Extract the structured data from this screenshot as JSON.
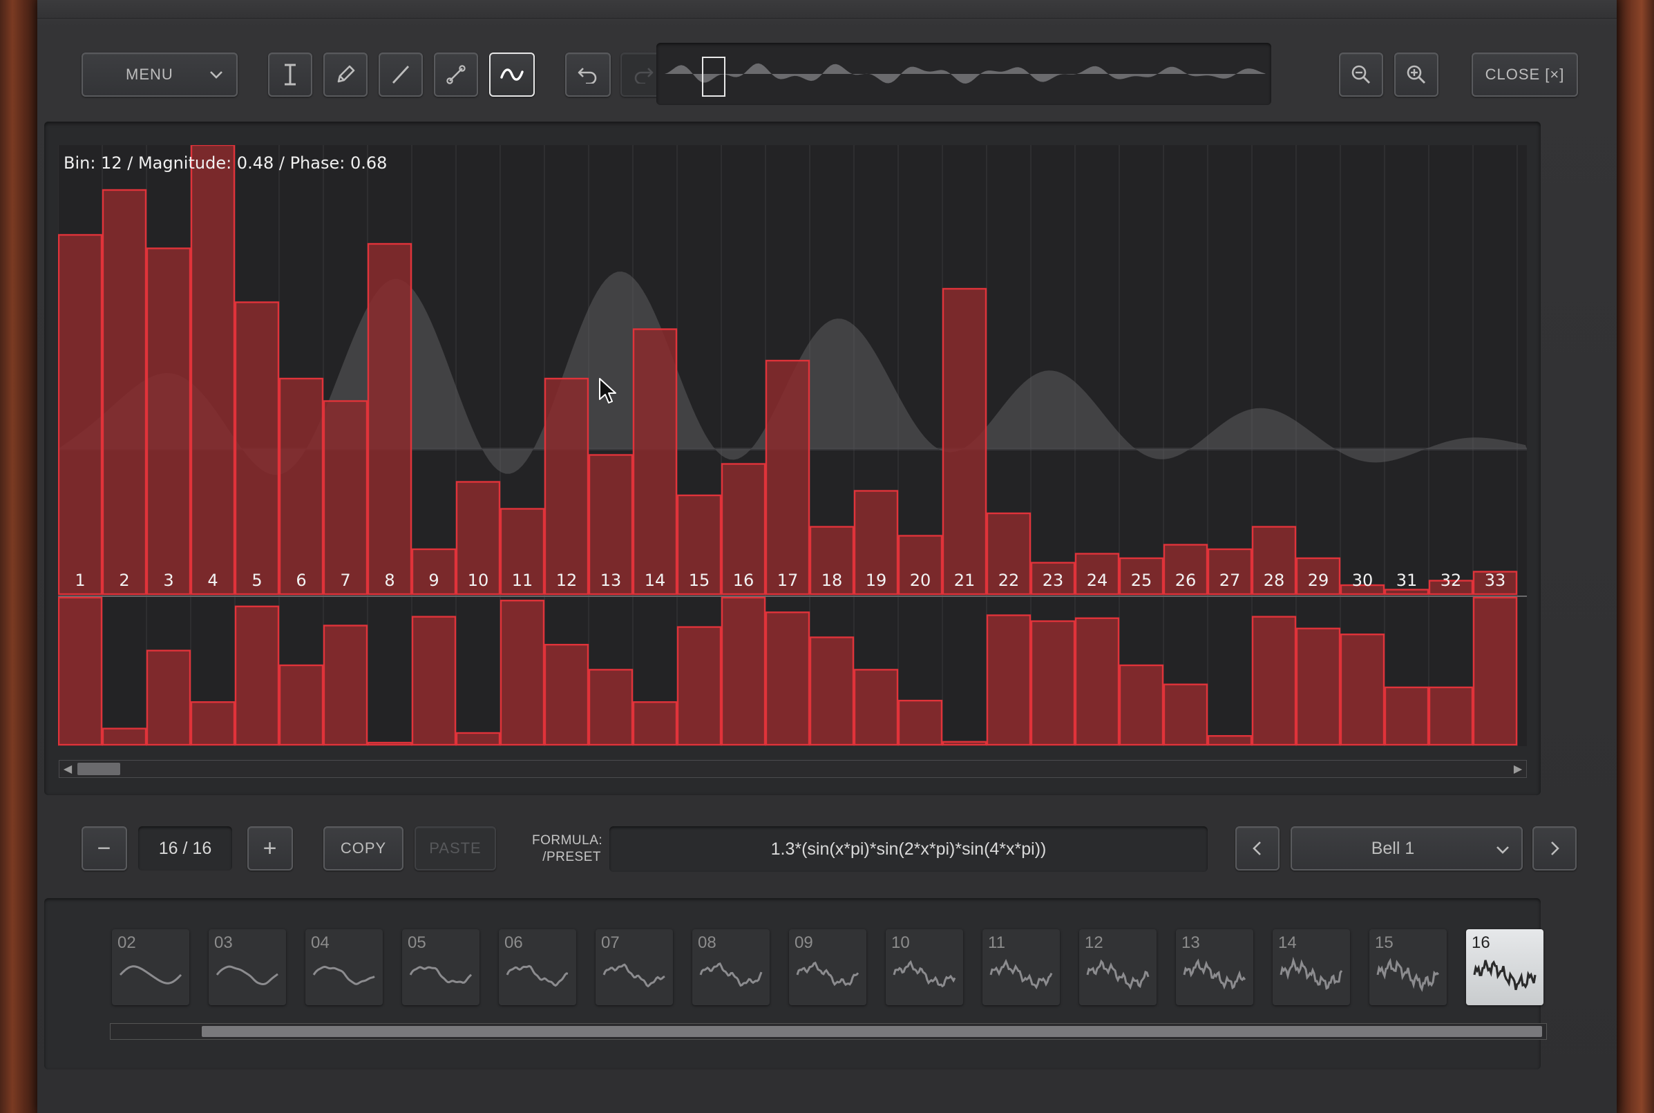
{
  "toolbar": {
    "menu_label": "MENU",
    "close_label": "CLOSE [×]",
    "tools": [
      "text-cursor-icon",
      "pencil-icon",
      "line-icon",
      "curve-icon",
      "sine-icon"
    ],
    "active_tool": "sine-icon"
  },
  "editor": {
    "readout": "Bin: 12 / Magnitude: 0.48 / Phase: 0.68",
    "bin_labels": [
      "1",
      "2",
      "3",
      "4",
      "5",
      "6",
      "7",
      "8",
      "9",
      "10",
      "11",
      "12",
      "13",
      "14",
      "15",
      "16",
      "17",
      "18",
      "19",
      "20",
      "21",
      "22",
      "23",
      "24",
      "25",
      "26",
      "27",
      "28",
      "29",
      "30",
      "31",
      "32",
      "33"
    ],
    "magnitudes": [
      0.8,
      0.9,
      0.77,
      1.0,
      0.65,
      0.48,
      0.43,
      0.78,
      0.1,
      0.25,
      0.19,
      0.48,
      0.31,
      0.59,
      0.22,
      0.29,
      0.52,
      0.15,
      0.23,
      0.13,
      0.68,
      0.18,
      0.07,
      0.09,
      0.08,
      0.11,
      0.1,
      0.15,
      0.08,
      0.02,
      0.01,
      0.03,
      0.05
    ],
    "phases": [
      1.0,
      0.11,
      0.64,
      0.29,
      0.94,
      0.54,
      0.81,
      0.01,
      0.87,
      0.08,
      0.98,
      0.68,
      0.51,
      0.29,
      0.8,
      1.0,
      0.9,
      0.73,
      0.51,
      0.3,
      0.02,
      0.88,
      0.84,
      0.86,
      0.54,
      0.41,
      0.06,
      0.87,
      0.79,
      0.75,
      0.39,
      0.39,
      1.0
    ]
  },
  "wavetable": {
    "decrement_label": "−",
    "position": "16 / 16",
    "increment_label": "+",
    "copy_label": "COPY",
    "paste_label": "PASTE",
    "formula_label_1": "FORMULA:",
    "formula_label_2": "/PRESET",
    "formula": "1.3*(sin(x*pi)*sin(2*x*pi)*sin(4*x*pi))",
    "preset": "Bell 1",
    "prev_label": "‹",
    "next_label": "›"
  },
  "thumbnails": {
    "items": [
      "02",
      "03",
      "04",
      "05",
      "06",
      "07",
      "08",
      "09",
      "10",
      "11",
      "12",
      "13",
      "14",
      "15",
      "16"
    ],
    "selected": "16"
  },
  "colors": {
    "bar_fill": "#8a2a2d",
    "bar_edge": "#e0333a",
    "wave_fill": "#5c5c5f",
    "selected_tile": "#dfe2e4"
  }
}
